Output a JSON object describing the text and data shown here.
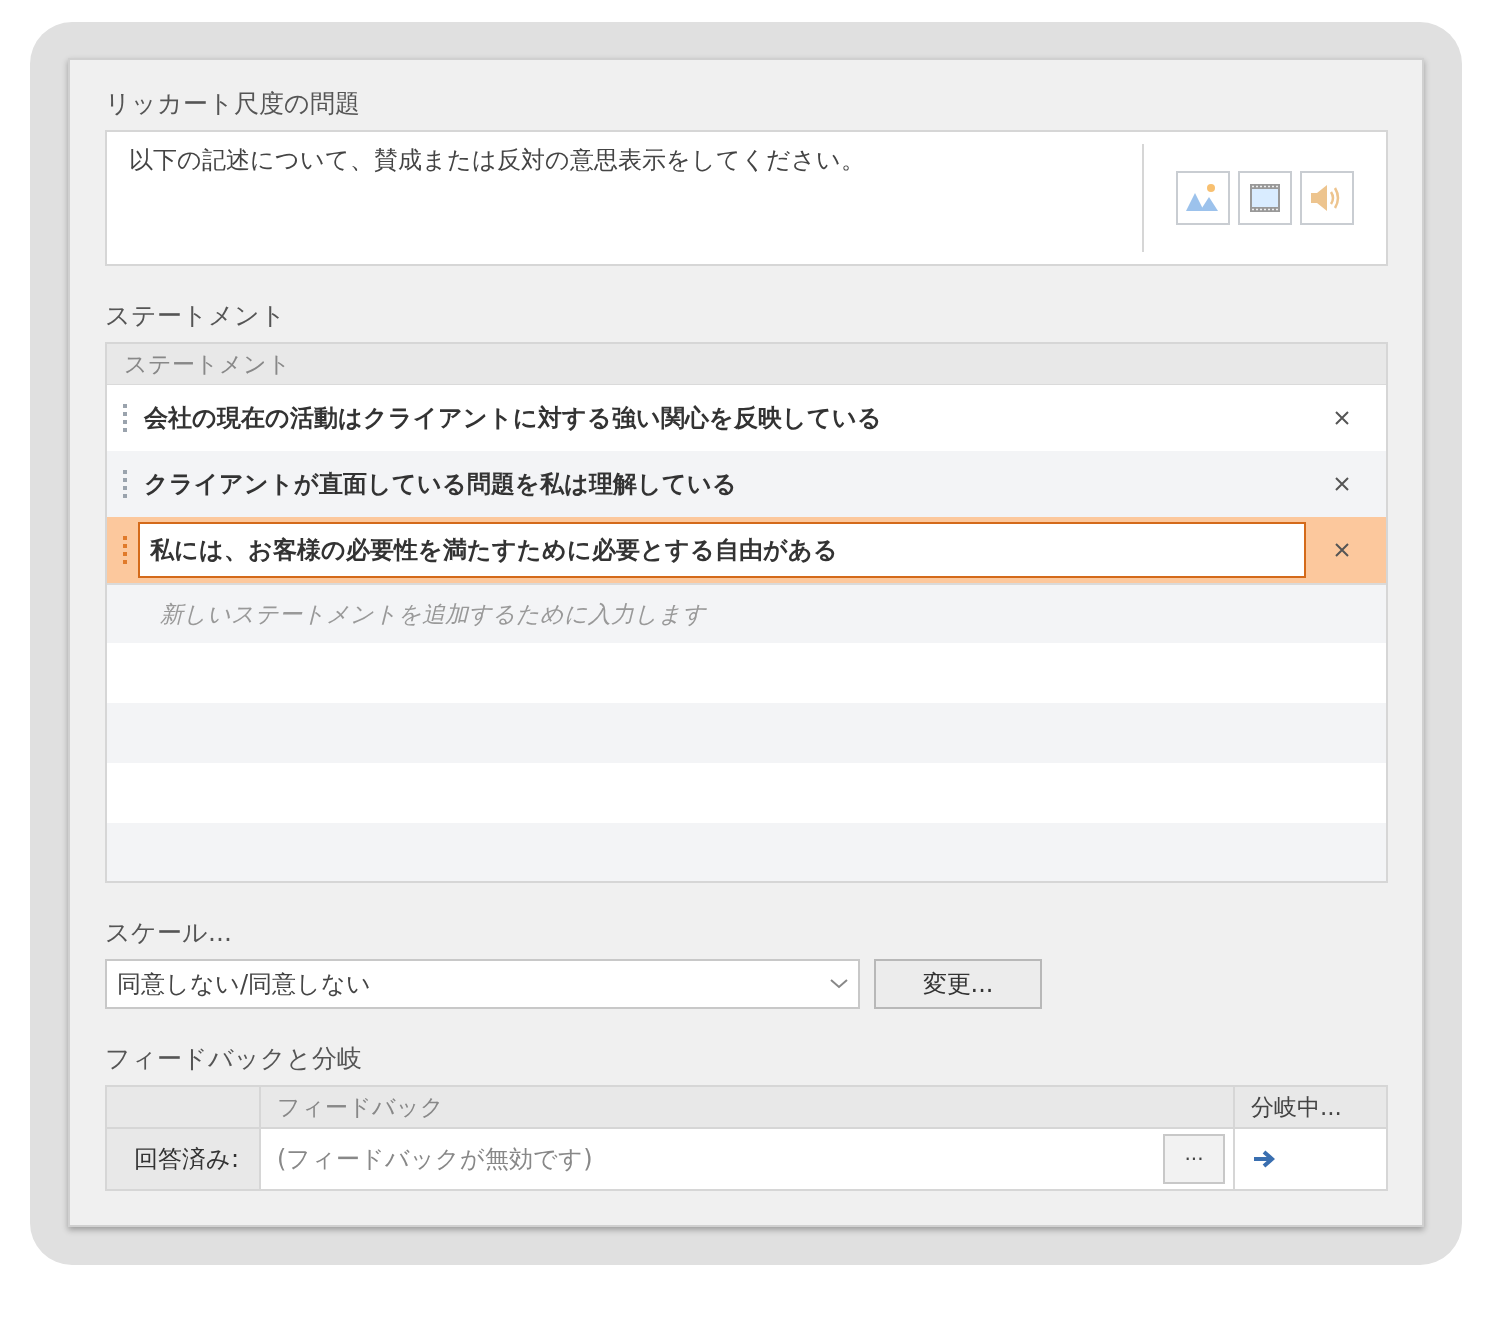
{
  "question": {
    "label": "リッカート尺度の問題",
    "text": "以下の記述について、賛成または反対の意思表示をしてください。"
  },
  "statements": {
    "label": "ステートメント",
    "column": "ステートメント",
    "rows": [
      {
        "text": "会社の現在の活動はクライアントに対する強い関心を反映している",
        "selected": false
      },
      {
        "text": "クライアントが直面している問題を私は理解している",
        "selected": false
      },
      {
        "text": "私には、お客様の必要性を満たすために必要とする自由がある",
        "selected": true
      }
    ],
    "placeholder": "新しいステートメントを追加するために入力します"
  },
  "scale": {
    "label": "スケール...",
    "value": "同意しない/同意しない",
    "button": "変更..."
  },
  "feedback": {
    "label": "フィードバックと分岐",
    "columns": [
      "フィードバック",
      "分岐中..."
    ],
    "rows": [
      {
        "header": "回答済み:",
        "feedback": "(フィードバックが無効です)",
        "more": "···"
      }
    ]
  }
}
